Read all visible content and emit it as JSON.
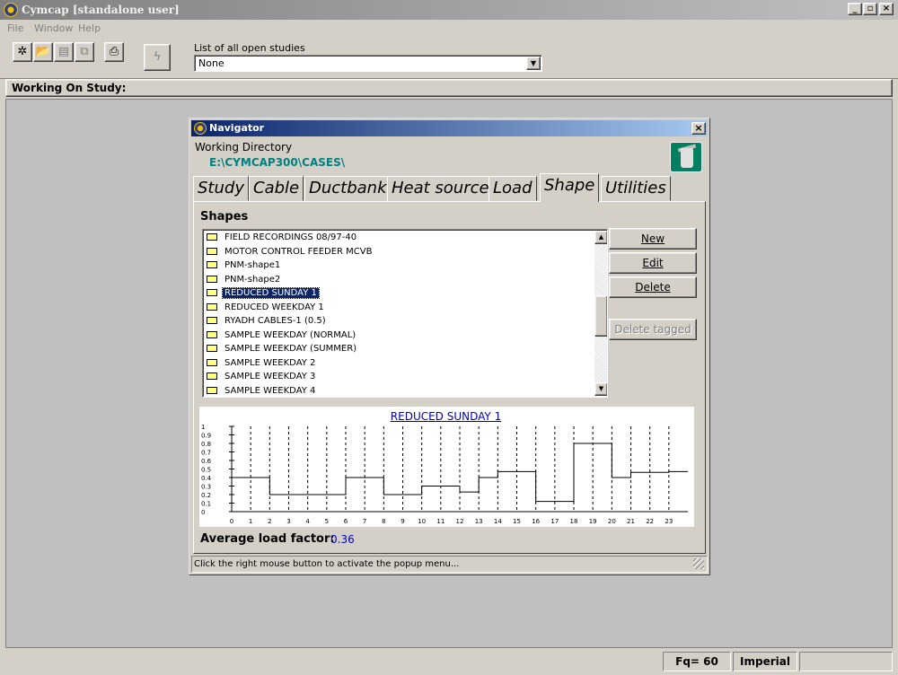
{
  "app": {
    "title": "Cymcap [standalone user]",
    "menu": [
      "File",
      "Window",
      "Help"
    ],
    "studies_label": "List of all open studies",
    "studies_value": "None",
    "working_on_study_label": "Working On Study:",
    "status": {
      "fq": "Fq= 60",
      "units": "Imperial"
    }
  },
  "navigator": {
    "title": "Navigator",
    "working_directory_label": "Working Directory",
    "working_directory": "E:\\CYMCAP300\\CASES\\",
    "tabs": [
      {
        "label": "Study",
        "active": false
      },
      {
        "label": "Cable",
        "active": false
      },
      {
        "label": "Ductbank",
        "active": false
      },
      {
        "label": "Heat source",
        "active": false
      },
      {
        "label": "Load",
        "active": false
      },
      {
        "label": "Shape",
        "active": true
      },
      {
        "label": "Utilities",
        "active": false
      }
    ],
    "shapes_label": "Shapes",
    "shapes": [
      "FIELD RECORDINGS 08/97-40",
      "MOTOR CONTROL FEEDER MCVB",
      "PNM-shape1",
      "PNM-shape2",
      "REDUCED SUNDAY 1",
      "REDUCED WEEKDAY 1",
      "RYADH CABLES-1 (0.5)",
      "SAMPLE WEEKDAY (NORMAL)",
      "SAMPLE WEEKDAY (SUMMER)",
      "SAMPLE WEEKDAY 2",
      "SAMPLE WEEKDAY 3",
      "SAMPLE WEEKDAY 4"
    ],
    "selected_shape": "REDUCED SUNDAY 1",
    "buttons": {
      "new": "New",
      "edit": "Edit",
      "delete": "Delete",
      "delete_tagged": "Delete tagged"
    },
    "average_load_factor_label": "Average load factor:",
    "average_load_factor": "0.36",
    "status_text": "Click the right mouse button to activate the popup menu..."
  },
  "chart_data": {
    "type": "line",
    "step": true,
    "title": "REDUCED SUNDAY 1",
    "x": [
      0,
      1,
      2,
      3,
      4,
      5,
      6,
      7,
      8,
      9,
      10,
      11,
      12,
      13,
      14,
      15,
      16,
      17,
      18,
      19,
      20,
      21,
      22,
      23
    ],
    "y_tick_labels": [
      "0",
      "0.1",
      "0.2",
      "0.3",
      "0.4",
      "0.5",
      "0.6",
      "0.7",
      "0.8",
      "0.9",
      "1"
    ],
    "values": [
      0.4,
      0.4,
      0.2,
      0.2,
      0.2,
      0.2,
      0.4,
      0.4,
      0.2,
      0.2,
      0.3,
      0.3,
      0.23,
      0.4,
      0.47,
      0.47,
      0.12,
      0.12,
      0.8,
      0.8,
      0.4,
      0.46,
      0.46,
      0.47
    ],
    "ylim": [
      0,
      1
    ],
    "xlim": [
      0,
      24
    ],
    "grid": "vertical-dashed"
  }
}
